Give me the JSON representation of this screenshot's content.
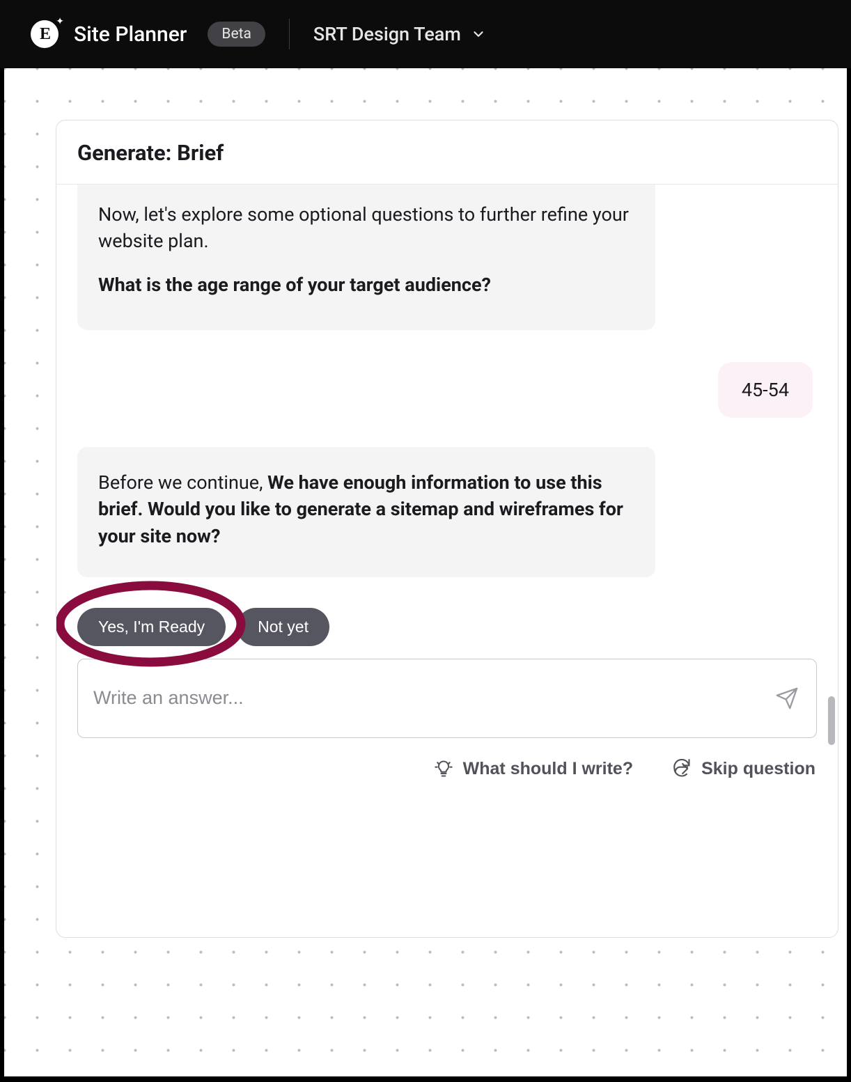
{
  "header": {
    "app_title": "Site Planner",
    "beta_label": "Beta",
    "team_name": "SRT Design Team"
  },
  "card": {
    "title": "Generate: Brief"
  },
  "chat": {
    "ai1_line1": "Now, let's explore some optional questions to further refine your website plan.",
    "ai1_question": "What is the age range of your target audience?",
    "user_reply": "45-54",
    "ai2_prefix": "Before we continue, ",
    "ai2_bold": "We have enough information to use this brief. Would you like to generate a sitemap and wireframes for your site now?"
  },
  "chips": {
    "yes": "Yes, I'm Ready",
    "no": "Not yet"
  },
  "input": {
    "placeholder": "Write an answer..."
  },
  "helpers": {
    "hint": "What should I write?",
    "skip": "Skip question"
  }
}
